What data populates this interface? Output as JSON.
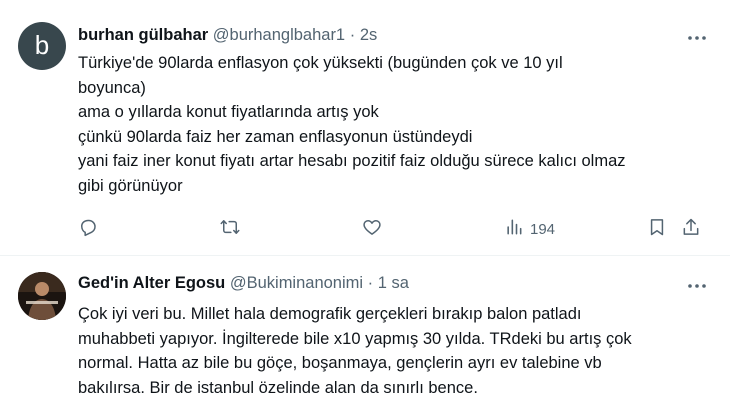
{
  "tweets": [
    {
      "avatar_letter": "b",
      "name": "burhan gülbahar",
      "handle": "@burhanglbahar1",
      "separator": "·",
      "time": "2s",
      "lines": [
        "Türkiye'de 90larda enflasyon çok yüksekti (bugünden çok ve 10 yıl",
        "boyunca)",
        "ama o yıllarda konut fiyatlarında artış yok",
        "çünkü 90larda faiz her zaman enflasyonun üstündeydi",
        "yani faiz iner konut fiyatı artar hesabı pozitif faiz olduğu sürece kalıcı olmaz",
        "gibi görünüyor"
      ],
      "actions": {
        "views": "194"
      }
    },
    {
      "avatar_text": "ALTER EGO",
      "name": "Ged'in Alter Egosu",
      "handle": "@Bukiminanonimi",
      "separator": "·",
      "time": "1 sa",
      "lines": [
        "Çok iyi veri bu. Millet hala demografik gerçekleri bırakıp balon patladı",
        "muhabbeti yapıyor. İngilterede bile x10 yapmış 30 yılda. TRdeki bu artış çok",
        "normal. Hatta az bile bu göçe, boşanmaya, gençlerin ayrı ev talebine vb",
        "bakılırsa. Bir de istanbul özelinde alan da sınırlı bence."
      ]
    }
  ],
  "icons": {
    "reply": "reply-icon",
    "retweet": "retweet-icon",
    "like": "like-icon",
    "views": "views-icon",
    "bookmark": "bookmark-icon",
    "share": "share-icon",
    "more": "more-icon"
  },
  "colors": {
    "text": "#0f1419",
    "secondary": "#536471",
    "divider": "#eff3f4",
    "avatar_bg": "#38474d"
  }
}
